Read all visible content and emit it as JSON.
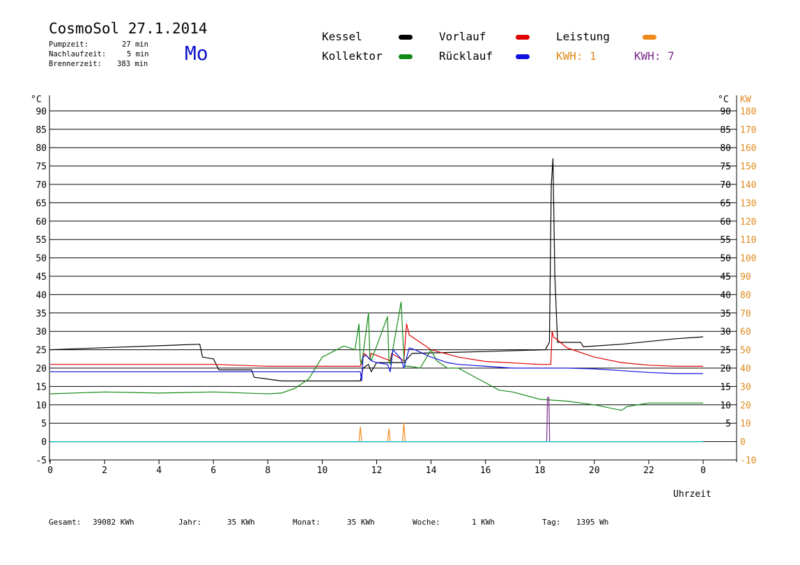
{
  "header": {
    "title": "CosmoSol 27.1.2014",
    "day": "Mo",
    "stats": [
      {
        "label": "Pumpzeit:",
        "value": "27 min"
      },
      {
        "label": "Nachlaufzeit:",
        "value": "5 min"
      },
      {
        "label": "Brennerzeit:",
        "value": "383 min"
      }
    ]
  },
  "legend": {
    "items": [
      {
        "label": "Kessel",
        "color": "#000000"
      },
      {
        "label": "Vorlauf",
        "color": "#e00000"
      },
      {
        "label": "Leistung",
        "color": "#f08a1c"
      },
      {
        "label": "Kollektor",
        "color": "#138a13"
      },
      {
        "label": "Rücklauf",
        "color": "#1010e0"
      }
    ],
    "kwh": [
      {
        "label": "KWH: 1",
        "color": "#e08a1c"
      },
      {
        "label": "KWH: 7",
        "color": "#7a2a8a"
      }
    ]
  },
  "footer": [
    {
      "label": "Gesamt:",
      "value": "39082 KWh"
    },
    {
      "label": "Jahr:",
      "value": "35 KWh"
    },
    {
      "label": "Monat:",
      "value": "35 KWh"
    },
    {
      "label": "Woche:",
      "value": "1 KWh"
    },
    {
      "label": "Tag:",
      "value": "1395 Wh"
    }
  ],
  "chart_data": {
    "type": "line",
    "xlabel": "Uhrzeit",
    "ylabel_left": "°C",
    "ylabel_right_1": "°C",
    "ylabel_right_2": "KW",
    "xlim": [
      0,
      24
    ],
    "ylim": [
      -5,
      95
    ],
    "x_ticks": [
      "0",
      "2",
      "4",
      "6",
      "8",
      "10",
      "12",
      "14",
      "16",
      "18",
      "20",
      "22",
      "0"
    ],
    "y_ticks_left": [
      "90",
      "85",
      "80",
      "75",
      "70",
      "65",
      "60",
      "55",
      "50",
      "45",
      "40",
      "35",
      "30",
      "25",
      "20",
      "15",
      "10",
      "5",
      "0",
      "-5"
    ],
    "y_ticks_right_c": [
      "90",
      "85",
      "80",
      "75",
      "70",
      "65",
      "60",
      "55",
      "50",
      "45",
      "40",
      "35",
      "30",
      "25",
      "20",
      "15",
      "10",
      "5"
    ],
    "y_ticks_right_kw": [
      "180",
      "170",
      "160",
      "150",
      "140",
      "130",
      "120",
      "110",
      "100",
      "90",
      "80",
      "70",
      "60",
      "50",
      "40",
      "30",
      "20",
      "10",
      "0",
      "-10"
    ],
    "grid": true,
    "series": [
      {
        "name": "Kessel",
        "color": "#000000",
        "x": [
          0,
          5.5,
          5.6,
          6,
          6.2,
          7.4,
          7.5,
          8.5,
          11.4,
          11.5,
          11.7,
          11.8,
          12,
          13,
          13.3,
          16,
          18.2,
          18.35,
          18.42,
          18.48,
          18.55,
          18.65,
          19.5,
          19.6,
          21,
          23,
          24
        ],
        "y": [
          25,
          26.5,
          23,
          22.5,
          19.5,
          19.5,
          17.5,
          16.5,
          16.5,
          20,
          21,
          19,
          21.5,
          21.5,
          24,
          24.5,
          25,
          27,
          70,
          77,
          45,
          27,
          27,
          25.8,
          26.5,
          28,
          28.5
        ]
      },
      {
        "name": "Vorlauf",
        "color": "#e00000",
        "x": [
          0,
          6,
          8,
          11.4,
          11.45,
          11.55,
          11.75,
          11.8,
          12.5,
          12.55,
          13,
          13.1,
          13.2,
          13.4,
          14,
          15,
          16,
          18,
          18.4,
          18.45,
          18.5,
          19,
          20,
          21,
          22,
          23,
          24
        ],
        "y": [
          21,
          21,
          20.5,
          20.5,
          22,
          24,
          22.5,
          24,
          22,
          24,
          22,
          32,
          29,
          28,
          25,
          23,
          21.8,
          21,
          21,
          30,
          28.5,
          25.5,
          23,
          21.5,
          20.8,
          20.5,
          20.5
        ]
      },
      {
        "name": "Kollektor",
        "color": "#138a13",
        "x": [
          0,
          2,
          4,
          6,
          8,
          8.5,
          9,
          9.5,
          10,
          10.4,
          10.8,
          11.2,
          11.35,
          11.4,
          11.45,
          11.7,
          11.75,
          11.8,
          12.4,
          12.45,
          12.5,
          12.9,
          13,
          13.05,
          13.2,
          13.6,
          14,
          14.2,
          14.6,
          15,
          15.5,
          16,
          16.5,
          17,
          18,
          19,
          20,
          21,
          21.2,
          22,
          23,
          24
        ],
        "y": [
          13,
          13.5,
          13.2,
          13.5,
          13,
          13.2,
          14.5,
          17,
          23,
          24.5,
          26,
          25,
          32,
          22,
          21,
          35,
          23,
          22,
          34,
          22,
          21,
          38,
          23,
          20.5,
          20.5,
          20,
          25,
          22,
          20,
          20,
          18,
          16,
          14,
          13.5,
          11.5,
          11,
          10,
          8.5,
          9.5,
          10.5,
          10.5,
          10.5
        ]
      },
      {
        "name": "Rücklauf",
        "color": "#1010e0",
        "x": [
          0,
          8,
          11.4,
          11.45,
          11.5,
          11.6,
          11.8,
          12,
          12.4,
          12.5,
          12.6,
          12.9,
          13,
          13.2,
          13.4,
          14,
          14.6,
          15,
          16,
          17,
          18,
          19,
          20,
          21,
          22,
          23,
          24
        ],
        "y": [
          19,
          19,
          19,
          16.5,
          23,
          23.5,
          22,
          21.5,
          21,
          19,
          25,
          22.5,
          20,
          25.5,
          25,
          23,
          21.5,
          21,
          20.5,
          20,
          20,
          20,
          19.8,
          19.3,
          18.8,
          18.5,
          18.5
        ]
      },
      {
        "name": "Leistung",
        "color": "#f08a1c",
        "x": [
          0,
          11.35,
          11.4,
          11.45,
          11.8,
          12.4,
          12.45,
          12.5,
          12.95,
          13,
          13.05,
          13.3,
          24
        ],
        "y": [
          0,
          0,
          4,
          0,
          0,
          0,
          3.5,
          0,
          0,
          5,
          0,
          0,
          0
        ]
      },
      {
        "name": "Brenner",
        "color": "#7a2a8a",
        "x": [
          0,
          18.25,
          18.28,
          18.33,
          18.36,
          24
        ],
        "y": [
          0,
          0,
          12,
          12,
          0,
          0
        ]
      },
      {
        "name": "Pumpe",
        "color": "#00c8d8",
        "x": [
          0,
          24
        ],
        "y": [
          0,
          0
        ]
      }
    ]
  }
}
